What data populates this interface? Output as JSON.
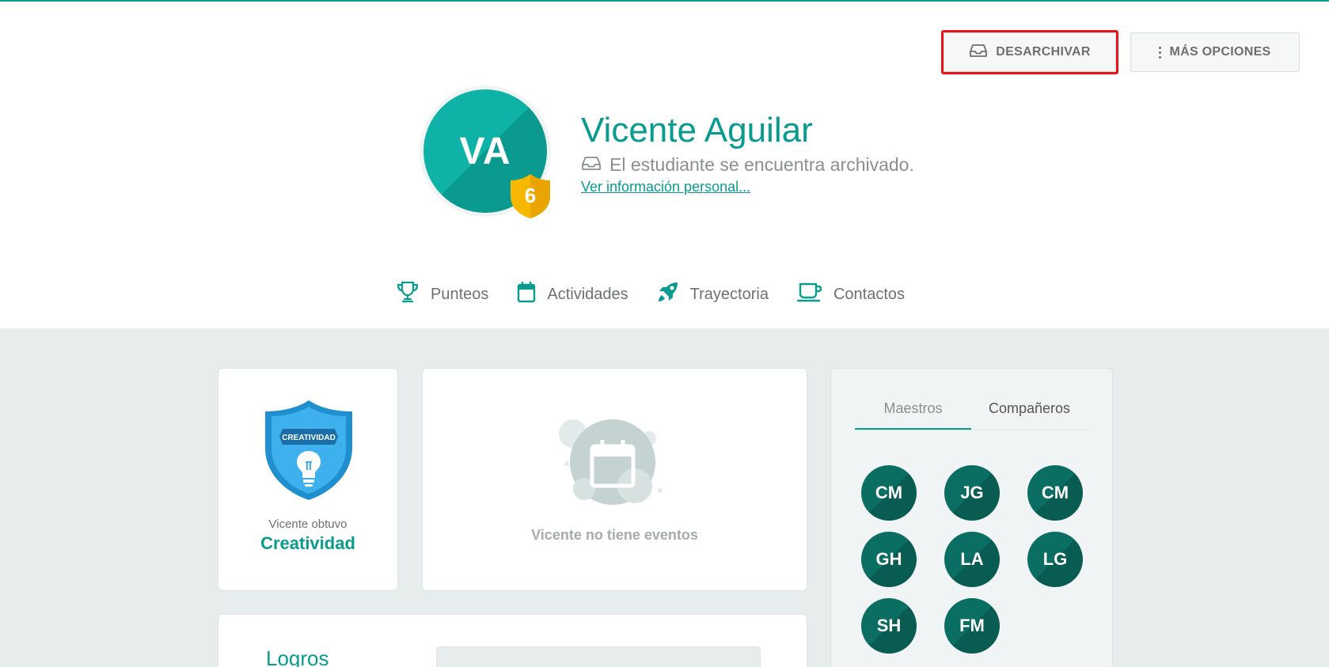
{
  "header": {
    "unarchive_label": "DESARCHIVAR",
    "more_options_label": "MÁS OPCIONES"
  },
  "student": {
    "initials": "VA",
    "level": "6",
    "name": "Vicente Aguilar",
    "status": "El estudiante se encuentra archivado.",
    "personal_info_link": "Ver información personal..."
  },
  "tabs": [
    {
      "label": "Punteos",
      "icon": "trophy-icon"
    },
    {
      "label": "Actividades",
      "icon": "calendar-icon"
    },
    {
      "label": "Trayectoria",
      "icon": "rocket-icon"
    },
    {
      "label": "Contactos",
      "icon": "coffee-cup-icon"
    }
  ],
  "award": {
    "badge_text": "CREATIVIDAD",
    "caption": "Vicente obtuvo",
    "title": "Creatividad"
  },
  "events": {
    "empty_text": "Vicente no tiene eventos"
  },
  "contacts": {
    "tabs": [
      "Maestros",
      "Compañeros"
    ],
    "active_tab": "Maestros",
    "people": [
      "CM",
      "JG",
      "CM",
      "GH",
      "LA",
      "LG",
      "SH",
      "FM"
    ]
  },
  "logros": {
    "title": "Logros"
  },
  "colors": {
    "accent": "#0a9b8f",
    "highlight": "#e8141b",
    "contact_avatar": "#0b6e63",
    "badge": "#f6b900",
    "award_shield": "#2a9ee0"
  }
}
